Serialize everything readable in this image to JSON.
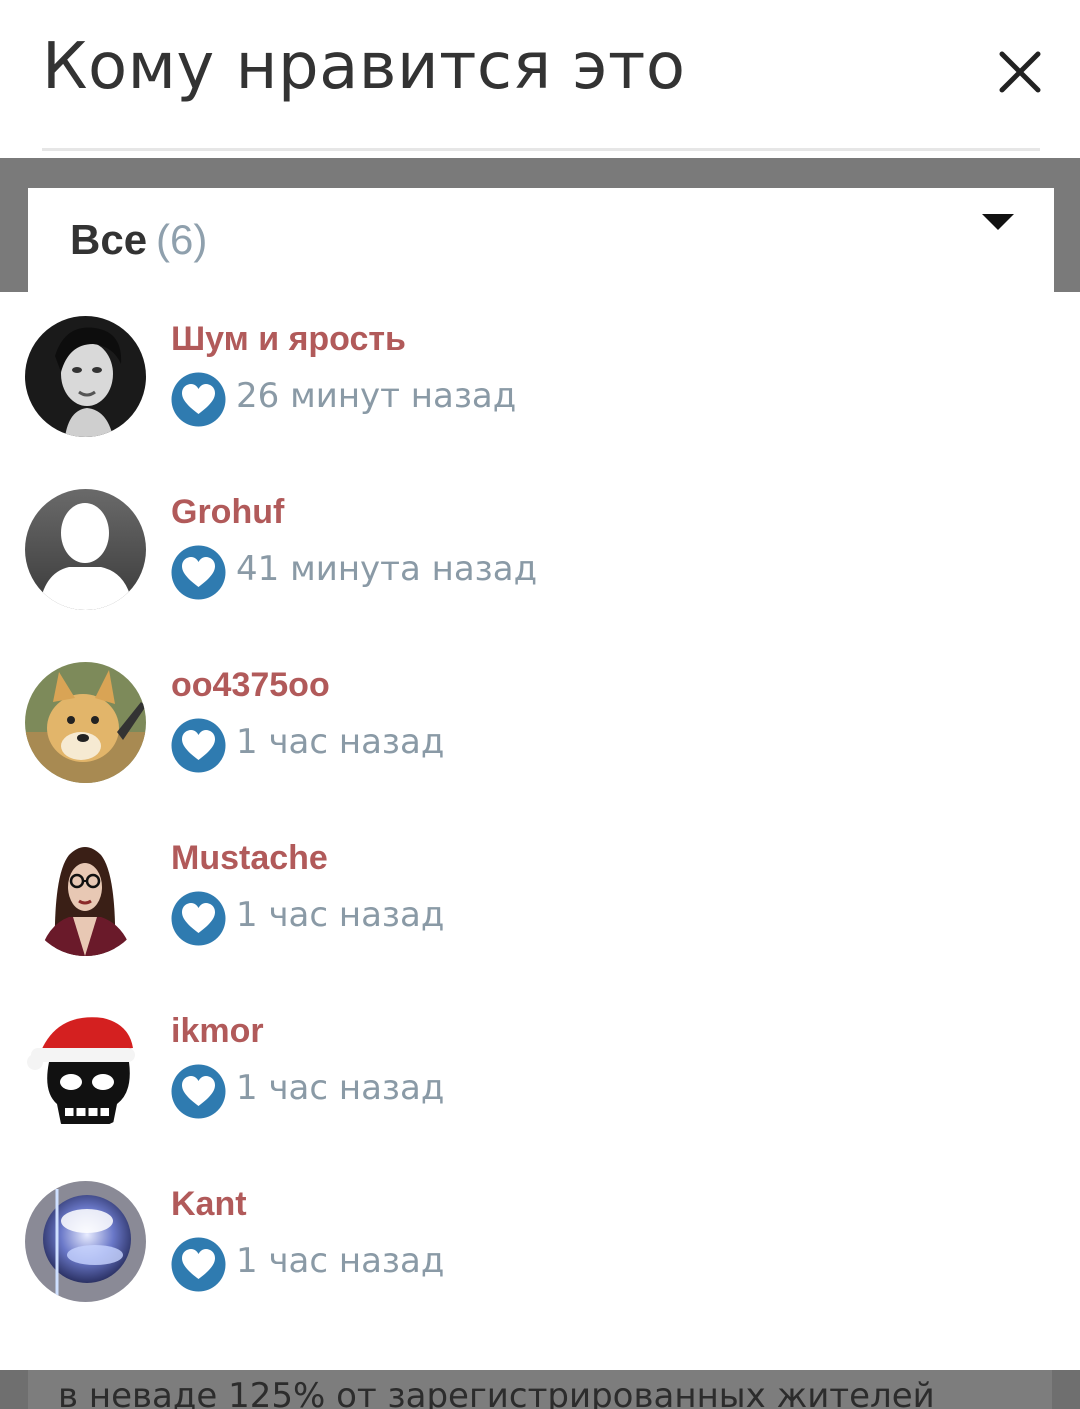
{
  "header": {
    "title": "Кому нравится это",
    "close_icon": "close-icon"
  },
  "filter": {
    "label": "Все",
    "count": "(6)",
    "arrow_icon": "caret-down-icon"
  },
  "likes": [
    {
      "name": "Шум и ярость",
      "time": "26 минут назад",
      "avatar": "portrait-woman"
    },
    {
      "name": "Grohuf",
      "time": "41 минута назад",
      "avatar": "default-silhouette"
    },
    {
      "name": "oo4375oo",
      "time": "1 час назад",
      "avatar": "doge"
    },
    {
      "name": "Mustache",
      "time": "1 час назад",
      "avatar": "woman-glasses"
    },
    {
      "name": "ikmor",
      "time": "1 час назад",
      "avatar": "skull-santa-hat"
    },
    {
      "name": "Kant",
      "time": "1 час назад",
      "avatar": "glass-orb"
    }
  ],
  "background_text": "в неваде 125% от зарегистрированных жителей",
  "colors": {
    "username": "#b15a5a",
    "time": "#8a9aa6",
    "heart_badge": "#2f7bb0",
    "overlay": "#7a7a7a"
  }
}
